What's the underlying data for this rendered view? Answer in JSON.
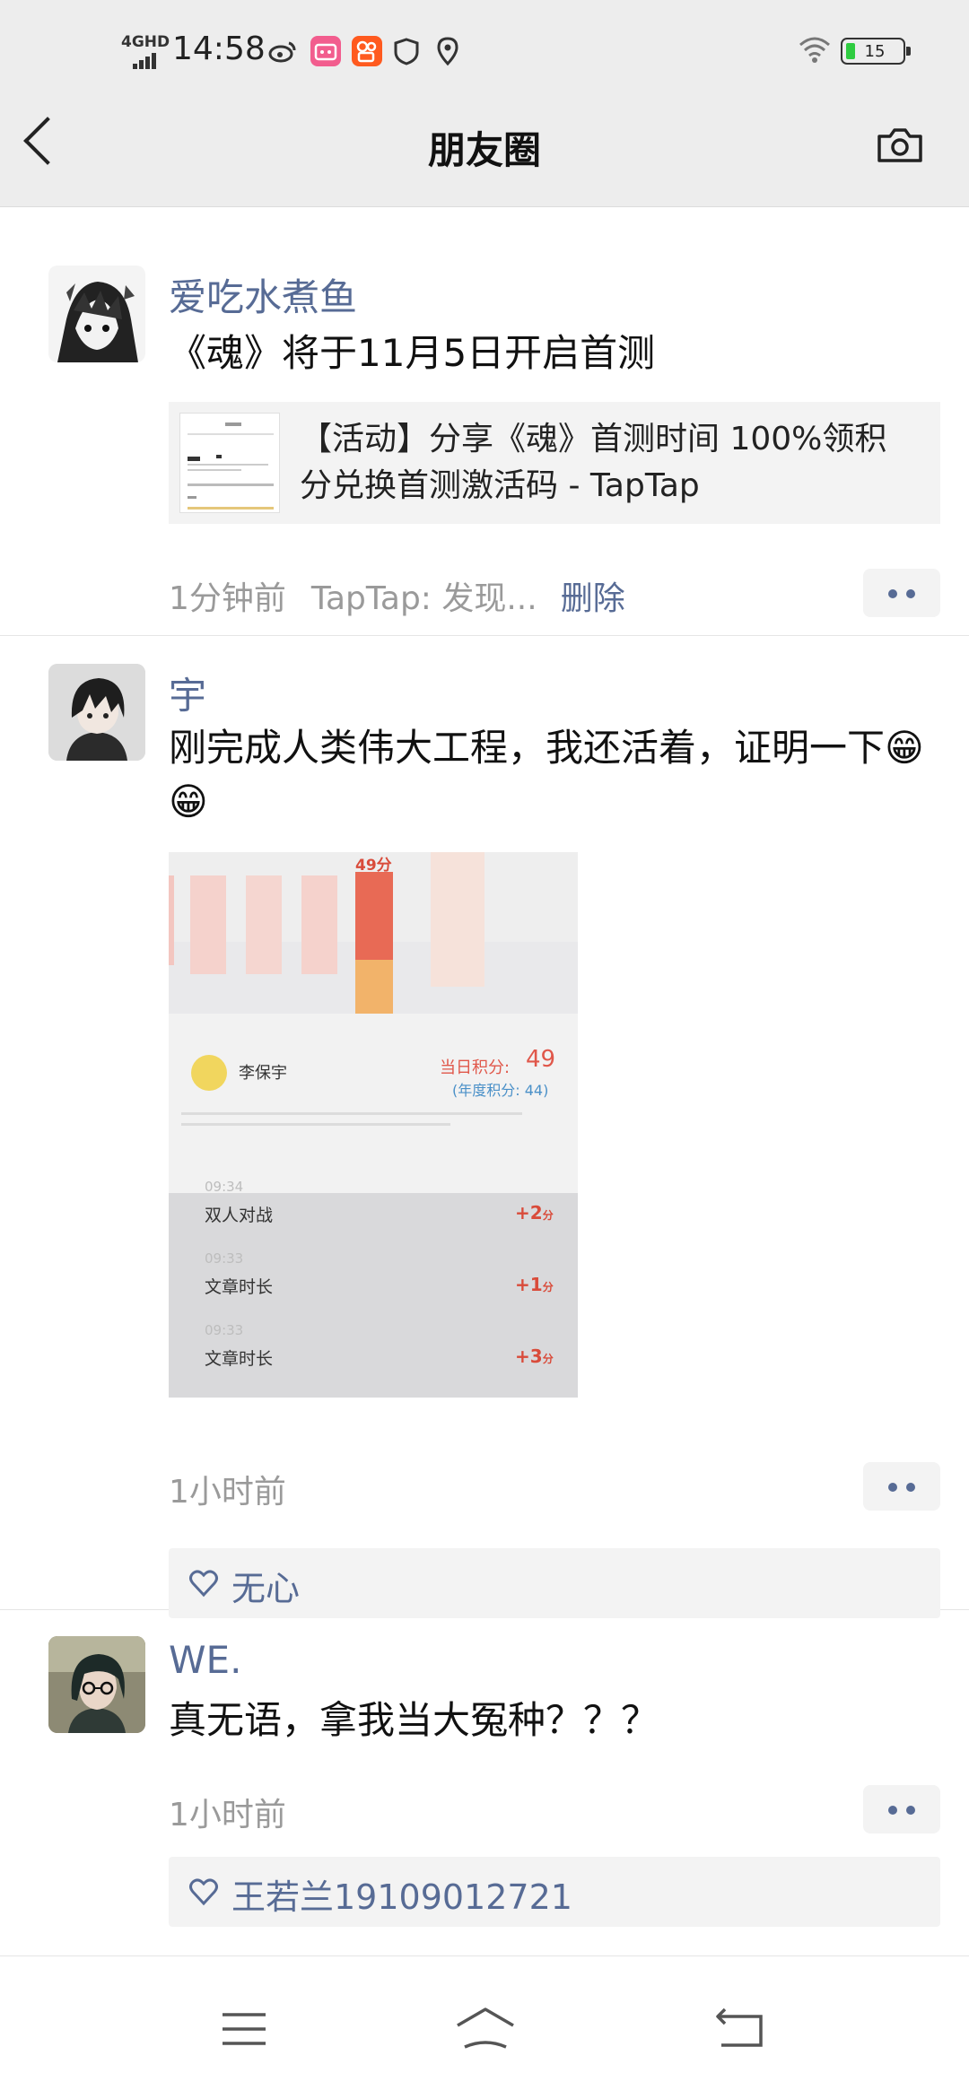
{
  "status_bar": {
    "network": "4GHD",
    "time": "14:58",
    "battery": "15"
  },
  "header": {
    "title": "朋友圈"
  },
  "posts": [
    {
      "name": "爱吃水煮鱼",
      "text": "《魂》将于11月5日开启首测",
      "link_card": {
        "title": "【活动】分享《魂》首测时间 100%领积分兑换首测激活码 - TapTap"
      },
      "time": "1分钟前",
      "source": "TapTap: 发现...",
      "delete": "删除"
    },
    {
      "name": "宇",
      "text": "刚完成人类伟大工程，我还活着，证明一下😁😁",
      "image": {
        "bar_label": "49分",
        "user": "李保宇",
        "today_label": "当日积分:",
        "today_score": "49",
        "year_score": "(年度积分: 44)",
        "items": [
          {
            "time": "09:34",
            "label": "双人对战",
            "score": "+2"
          },
          {
            "time": "09:33",
            "label": "文章时长",
            "score": "+1"
          },
          {
            "time": "09:33",
            "label": "文章时长",
            "score": "+3"
          }
        ],
        "unit": "分"
      },
      "time": "1小时前",
      "likes": "无心"
    },
    {
      "name": "WE.",
      "text": "真无语，拿我当大冤种？？？",
      "time": "1小时前",
      "likes": "王若兰19109012721"
    }
  ]
}
